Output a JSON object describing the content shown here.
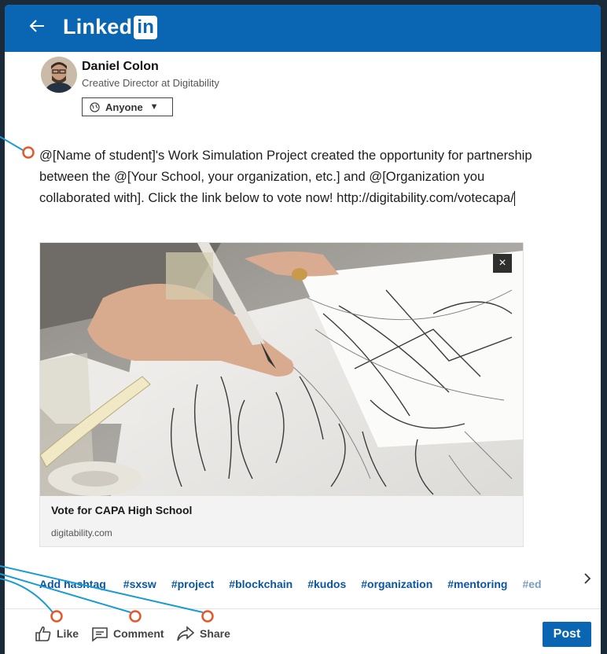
{
  "header": {
    "brand": "Linked",
    "brand_box": "in",
    "back_icon": "back-arrow-icon"
  },
  "author": {
    "name": "Daniel Colon",
    "title": "Creative Director at Digitability",
    "visibility": "Anyone"
  },
  "post": {
    "text": "@[Name of student]'s Work Simulation Project created the opportunity for partnership between the @[Your School, your organization, etc.] and @[Organization you collaborated with]. Click the link below to vote now! http://digitability.com/votecapa/"
  },
  "link_card": {
    "title": "Vote for CAPA High School",
    "domain": "digitability.com",
    "close_label": "×"
  },
  "hashtags": {
    "add_label": "Add hashtag",
    "tags": [
      "#sxsw",
      "#project",
      "#blockchain",
      "#kudos",
      "#organization",
      "#mentoring",
      "#ed"
    ],
    "next_icon": "chevron-right-icon"
  },
  "actions": {
    "like": "Like",
    "comment": "Comment",
    "share": "Share",
    "post": "Post"
  },
  "colors": {
    "brand": "#0a66b2",
    "annotation_line": "#1a9ad6",
    "annotation_dot": "#e8552a",
    "background": "#1b2a38"
  }
}
